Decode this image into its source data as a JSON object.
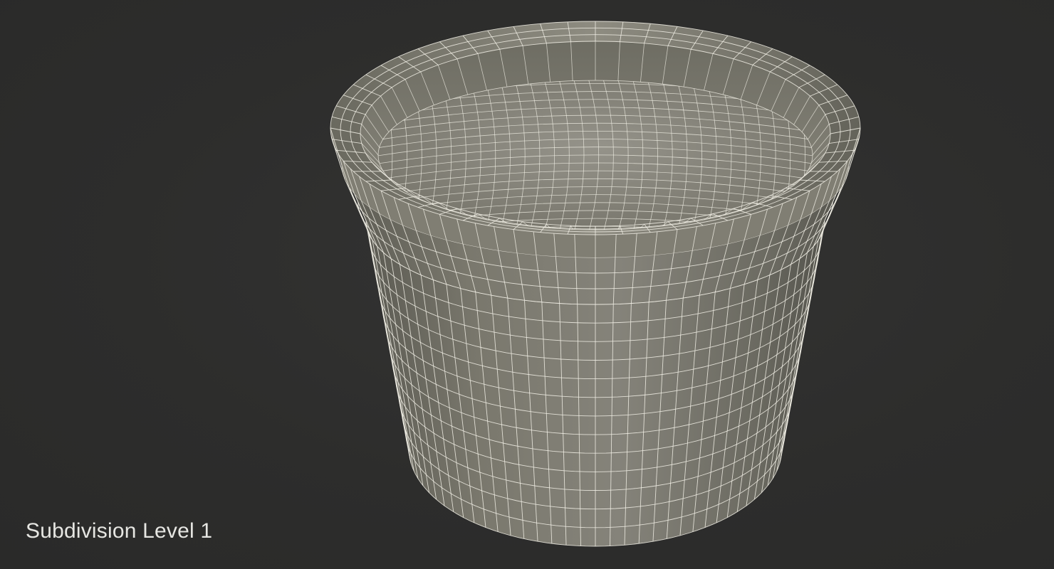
{
  "caption": "Subdivision Level 1",
  "colors": {
    "background": "#2c2c2b",
    "mesh_surface": "#7d7b70",
    "mesh_inner_floor": "#8b897e",
    "wireframe": "#f2f0e6",
    "caption_text": "#e6e6e2"
  }
}
